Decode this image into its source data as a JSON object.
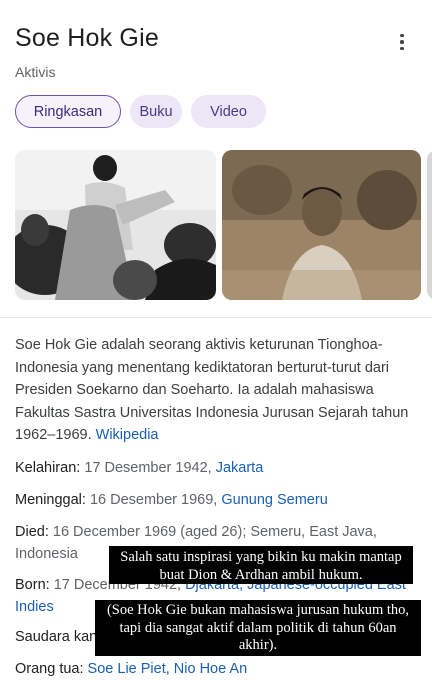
{
  "header": {
    "title": "Soe Hok Gie",
    "subtitle": "Aktivis",
    "menu_icon": "more-vert-icon"
  },
  "tabs": [
    {
      "label": "Ringkasan",
      "active": true
    },
    {
      "label": "Buku",
      "active": false
    },
    {
      "label": "Video",
      "active": false
    }
  ],
  "photos": [
    "historical-photo-group",
    "historical-photo-portrait"
  ],
  "description": {
    "text": "Soe Hok Gie adalah seorang aktivis keturunan Tionghoa-Indonesia yang menentang kediktatoran berturut-turut dari Presiden Soekarno dan Soeharto. Ia adalah mahasiswa Fakultas Sastra Universitas Indonesia Jurusan Sejarah tahun 1962–1969. ",
    "source_link": "Wikipedia"
  },
  "facts": {
    "born_id": {
      "key": "Kelahiran: ",
      "value": "17 Desember 1942, ",
      "link": "Jakarta"
    },
    "died_id": {
      "key": "Meninggal: ",
      "value": "16 Desember 1969, ",
      "link": "Gunung Semeru"
    },
    "died_en": {
      "key": "Died: ",
      "value": "16 December 1969 (aged 26); Semeru, East Java, Indonesia"
    },
    "born_en": {
      "key": "Born: ",
      "value": "17 December 1942, ",
      "link": "Djakarta, Japanese-occupied East Indies"
    },
    "sibling": {
      "key": "Saudara kan"
    },
    "parents": {
      "key": "Orang tua: ",
      "link": "Soe Lie Piet, Nio Hoe An"
    }
  },
  "overlay_captions": {
    "first": "Salah satu inspirasi yang bikin ku makin mantap buat Dion & Ardhan ambil hukum.",
    "second": "(Soe Hok Gie bukan mahasiswa jurusan hukum tho, tapi dia sangat aktif dalam politik di tahun 60an akhir)."
  },
  "colors": {
    "chip_bg": "#ece6f7",
    "chip_active_border": "#6a55b0",
    "link": "#1a5fb4",
    "caption_bg": "#000000"
  }
}
